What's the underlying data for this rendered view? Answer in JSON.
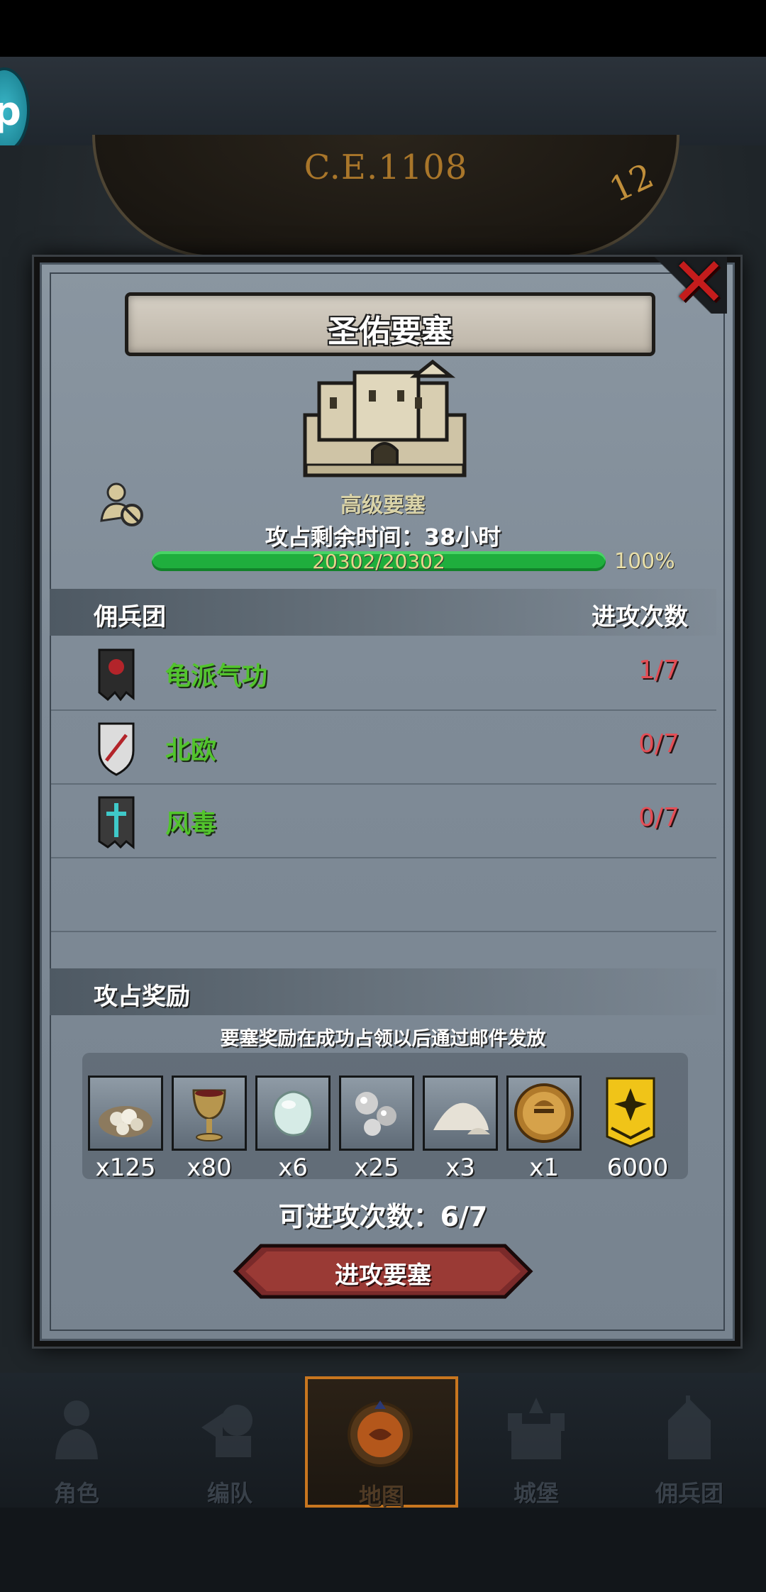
{
  "top": {
    "year": "C.E.1108",
    "dial_number": "12",
    "profile_letter": "p"
  },
  "modal": {
    "title": "圣佑要塞",
    "fortress_type": "高级要塞",
    "time_left": "攻占剩余时间：38小时",
    "hp_text": "20302/20302",
    "hp_percent": "100%",
    "hp_fraction": 1.0,
    "merc_section_label": "佣兵团",
    "attack_times_label": "进攻次数",
    "mercenaries": [
      {
        "name": "龟派气功",
        "count": "1/7",
        "flag_color": "#2b2b2b",
        "emblem_color": "#b3242a"
      },
      {
        "name": "北欧",
        "count": "0/7",
        "flag_color": "#dcdcdc",
        "emblem_color": "#b3242a"
      },
      {
        "name": "风毒",
        "count": "0/7",
        "flag_color": "#3a3a3a",
        "emblem_color": "#3fc9c9"
      }
    ],
    "reward_section_label": "攻占奖励",
    "reward_note": "要塞奖励在成功占领以后通过邮件发放",
    "rewards": [
      {
        "icon": "stone-pile-icon",
        "qty": "x125"
      },
      {
        "icon": "goblet-icon",
        "qty": "x80"
      },
      {
        "icon": "gem-icon",
        "qty": "x6"
      },
      {
        "icon": "silver-orbs-icon",
        "qty": "x25"
      },
      {
        "icon": "powder-pile-icon",
        "qty": "x3"
      },
      {
        "icon": "helmet-medal-icon",
        "qty": "x1"
      },
      {
        "icon": "rank-badge-icon",
        "qty": "6000"
      }
    ],
    "attack_count": "可进攻次数：6/7",
    "attack_button": "进攻要塞"
  },
  "nav": [
    {
      "label": "角色",
      "icon": "knight-icon",
      "active": false
    },
    {
      "label": "编队",
      "icon": "squad-icon",
      "active": false
    },
    {
      "label": "地图",
      "icon": "map-icon",
      "active": true
    },
    {
      "label": "城堡",
      "icon": "castle-icon",
      "active": false
    },
    {
      "label": "佣兵团",
      "icon": "mercenary-icon",
      "active": false
    }
  ]
}
